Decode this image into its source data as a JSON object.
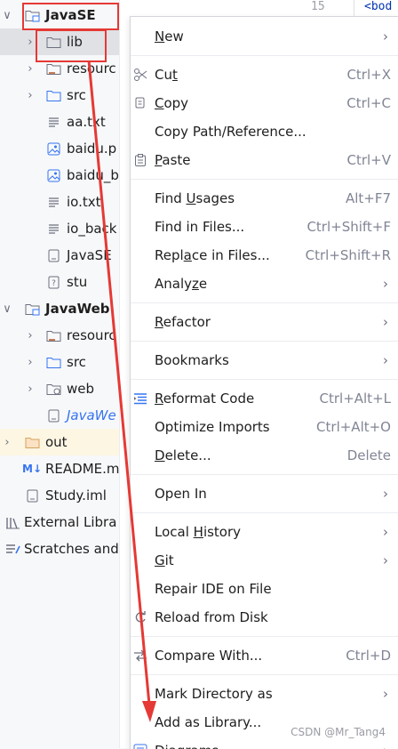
{
  "tree": {
    "items": [
      {
        "label": "JavaSE",
        "chev": "∨",
        "icon": "module-folder-icon",
        "bold": true
      },
      {
        "label": "lib",
        "chev": "›",
        "icon": "folder-icon"
      },
      {
        "label": "resourc",
        "chev": "›",
        "icon": "resources-folder-icon"
      },
      {
        "label": "src",
        "chev": "›",
        "icon": "source-folder-icon"
      },
      {
        "label": "aa.txt",
        "chev": "",
        "icon": "text-file-icon"
      },
      {
        "label": "baidu.p",
        "chev": "",
        "icon": "image-file-icon"
      },
      {
        "label": "baidu_b",
        "chev": "",
        "icon": "image-file-icon"
      },
      {
        "label": "io.txt",
        "chev": "",
        "icon": "text-file-icon"
      },
      {
        "label": "io_back",
        "chev": "",
        "icon": "text-file-icon"
      },
      {
        "label": "JavaSE",
        "chev": "",
        "icon": "iml-file-icon"
      },
      {
        "label": "stu",
        "chev": "",
        "icon": "unknown-file-icon"
      },
      {
        "label": "JavaWeb",
        "chev": "∨",
        "icon": "module-folder-icon",
        "bold": true
      },
      {
        "label": "resourc",
        "chev": "›",
        "icon": "resources-folder-icon"
      },
      {
        "label": "src",
        "chev": "›",
        "icon": "source-folder-icon"
      },
      {
        "label": "web",
        "chev": "›",
        "icon": "web-folder-icon"
      },
      {
        "label": "JavaWe",
        "chev": "",
        "icon": "iml-file-icon",
        "blue": true
      },
      {
        "label": "out",
        "chev": "›",
        "icon": "excluded-folder-icon"
      },
      {
        "label": "README.m",
        "chev": "",
        "icon": "markdown-file-icon",
        "badge": "M↓"
      },
      {
        "label": "Study.iml",
        "chev": "",
        "icon": "iml-file-icon"
      },
      {
        "label": "External Libra",
        "chev": "",
        "icon": "library-icon"
      },
      {
        "label": "Scratches and",
        "chev": "",
        "icon": "scratches-icon"
      }
    ]
  },
  "editor": {
    "line_number": "15",
    "code_peek": "<bod"
  },
  "menu": {
    "groups": [
      [
        {
          "label": "New",
          "u": 0,
          "arrow": true
        }
      ],
      [
        {
          "label": "Cut",
          "u": 2,
          "shortcut": "Ctrl+X",
          "icon": "scissors-icon"
        },
        {
          "label": "Copy",
          "u": 0,
          "shortcut": "Ctrl+C",
          "icon": "copy-icon"
        },
        {
          "label": "Copy Path/Reference...",
          "u": -1
        },
        {
          "label": "Paste",
          "u": 0,
          "shortcut": "Ctrl+V",
          "icon": "paste-icon"
        }
      ],
      [
        {
          "label": "Find Usages",
          "u": 5,
          "shortcut": "Alt+F7"
        },
        {
          "label": "Find in Files...",
          "u": -1,
          "shortcut": "Ctrl+Shift+F"
        },
        {
          "label": "Replace in Files...",
          "u": 4,
          "shortcut": "Ctrl+Shift+R"
        },
        {
          "label": "Analyze",
          "u": 5,
          "arrow": true
        }
      ],
      [
        {
          "label": "Refactor",
          "u": 0,
          "arrow": true
        }
      ],
      [
        {
          "label": "Bookmarks",
          "u": -1,
          "arrow": true
        }
      ],
      [
        {
          "label": "Reformat Code",
          "u": 0,
          "shortcut": "Ctrl+Alt+L",
          "icon": "reformat-icon"
        },
        {
          "label": "Optimize Imports",
          "u": -1,
          "shortcut": "Ctrl+Alt+O"
        },
        {
          "label": "Delete...",
          "u": 0,
          "shortcut": "Delete"
        }
      ],
      [
        {
          "label": "Open In",
          "u": -1,
          "arrow": true
        }
      ],
      [
        {
          "label": "Local History",
          "u": 6,
          "arrow": true
        },
        {
          "label": "Git",
          "u": 0,
          "arrow": true
        },
        {
          "label": "Repair IDE on File",
          "u": -1
        },
        {
          "label": "Reload from Disk",
          "u": -1,
          "icon": "reload-icon"
        }
      ],
      [
        {
          "label": "Compare With...",
          "u": -1,
          "shortcut": "Ctrl+D",
          "icon": "compare-icon"
        }
      ],
      [
        {
          "label": "Mark Directory as",
          "u": -1,
          "arrow": true
        },
        {
          "label": "Add as Library...",
          "u": -1
        },
        {
          "label": "Diagrams",
          "u": -1,
          "icon": "diagram-icon",
          "arrow": true
        }
      ]
    ]
  },
  "watermark": "CSDN @Mr_Tang4",
  "colors": {
    "annotation_red": "#e53935",
    "selection": "#dfe1e5",
    "highlight_row": "#fdf6e3",
    "accent_blue": "#3574f0"
  }
}
